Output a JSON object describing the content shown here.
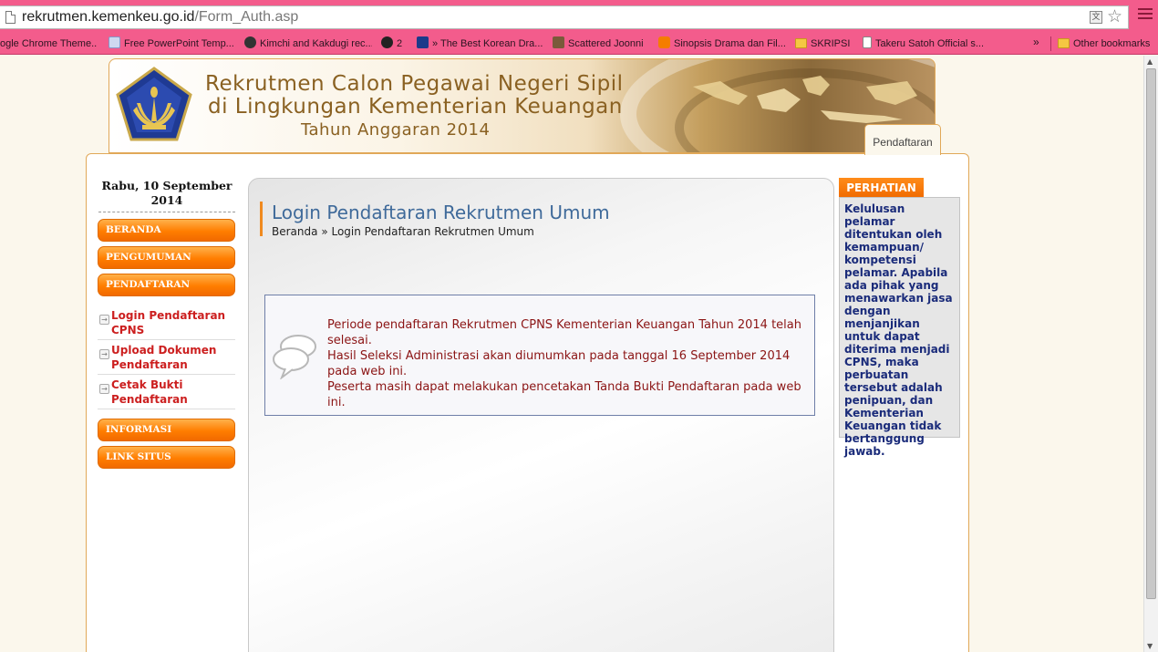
{
  "browser": {
    "url_host": "rekrutmen.kemenkeu.go.id",
    "url_path": "/Form_Auth.asp",
    "bookmarks": [
      {
        "label": "ogle Chrome Theme...",
        "icon": "none"
      },
      {
        "label": "Free PowerPoint Temp...",
        "icon": "page"
      },
      {
        "label": "Kimchi and Kakdugi rec...",
        "icon": "site"
      },
      {
        "label": "2",
        "icon": "site"
      },
      {
        "label": "» The Best Korean Dra...",
        "icon": "site"
      },
      {
        "label": "Scattered Joonni",
        "icon": "site"
      },
      {
        "label": "Sinopsis Drama dan Fil...",
        "icon": "blogger"
      },
      {
        "label": "SKRIPSI",
        "icon": "folder"
      },
      {
        "label": "Takeru Satoh Official s...",
        "icon": "doc"
      }
    ],
    "more": "»",
    "other_bookmarks": "Other bookmarks"
  },
  "banner": {
    "line1": "Rekrutmen Calon Pegawai Negeri Sipil",
    "line2": "di Lingkungan Kementerian Keuangan",
    "line3": "Tahun Anggaran 2014"
  },
  "top_tab": "Pendaftaran",
  "sidebar": {
    "date": "Rabu, 10 September 2014",
    "nav": [
      "BERANDA",
      "PENGUMUMAN",
      "PENDAFTARAN",
      "INFORMASI",
      "LINK SITUS"
    ],
    "sublinks": [
      "Login Pendaftaran CPNS",
      "Upload Dokumen Pendaftaran",
      "Cetak Bukti Pendaftaran"
    ]
  },
  "main": {
    "title": "Login Pendaftaran Rekrutmen Umum",
    "breadcrumb_home": "Beranda",
    "breadcrumb_sep": "»",
    "breadcrumb_current": "Login Pendaftaran Rekrutmen Umum",
    "notice_lines": [
      "Periode pendaftaran Rekrutmen CPNS Kementerian Keuangan Tahun 2014 telah selesai.",
      "Hasil Seleksi Administrasi akan diumumkan pada tanggal 16 September 2014 pada web ini.",
      "Peserta masih dapat melakukan pencetakan Tanda Bukti Pendaftaran pada web ini."
    ]
  },
  "perhatian": {
    "title": "PERHATIAN",
    "text": "Kelulusan pelamar ditentukan oleh kemampuan/ kompetensi pelamar. Apabila ada pihak yang menawarkan jasa dengan menjanjikan untuk dapat diterima menjadi CPNS, maka perbuatan tersebut adalah penipuan, dan Kementerian Keuangan tidak bertanggung jawab."
  }
}
